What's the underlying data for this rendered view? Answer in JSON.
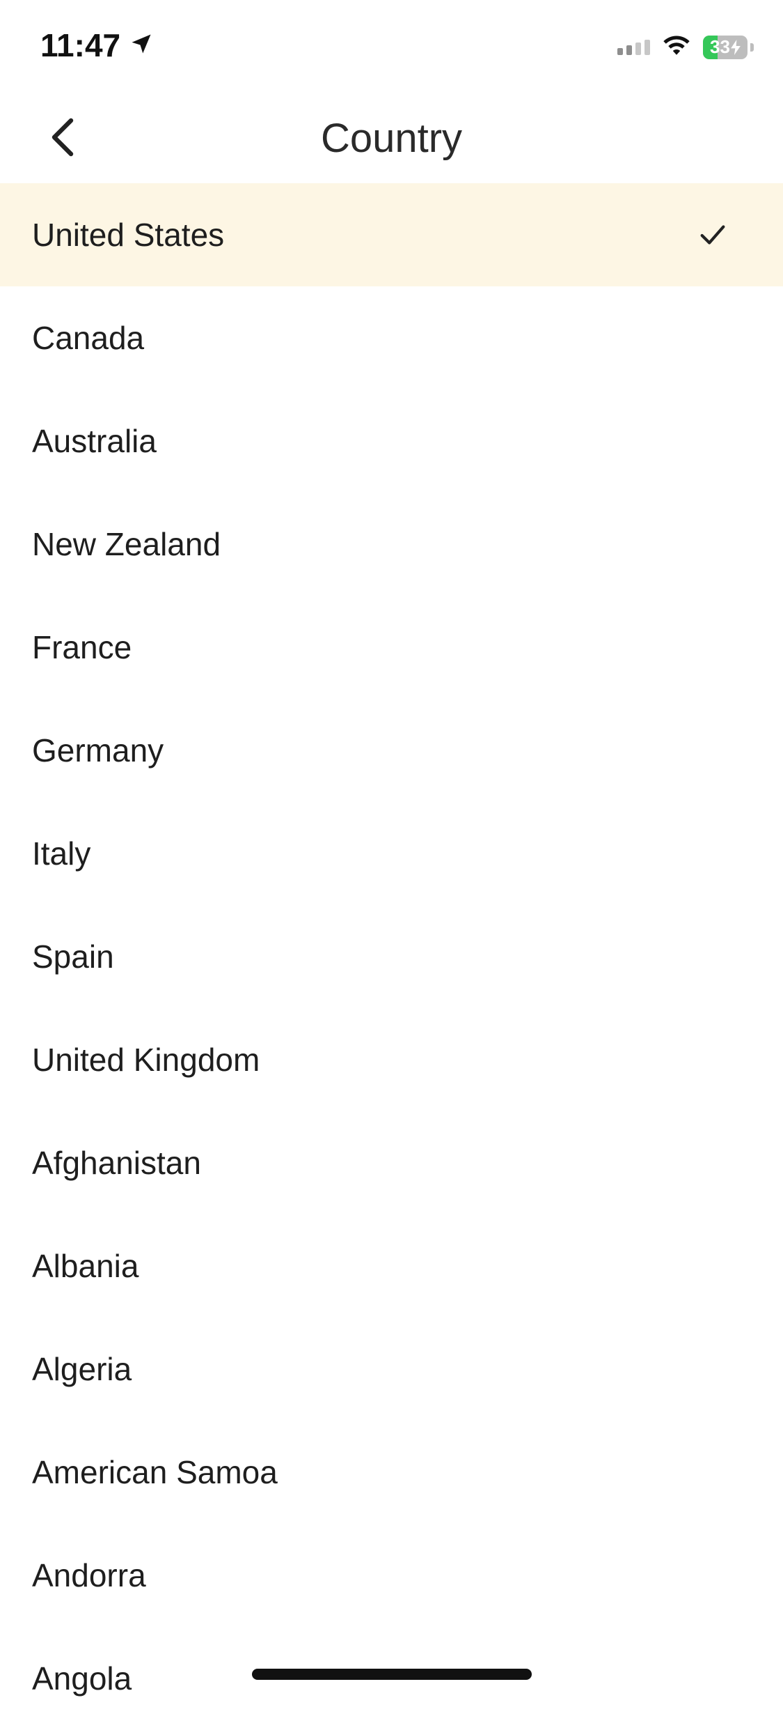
{
  "status_bar": {
    "time": "11:47",
    "battery_level": "33",
    "battery_fraction": 0.33,
    "icons": [
      "location-arrow-icon",
      "cellular-signal-icon",
      "wifi-icon",
      "battery-charging-icon"
    ]
  },
  "nav": {
    "title": "Country",
    "back_icon": "chevron-left-icon"
  },
  "countries": [
    {
      "label": "United States",
      "selected": true
    },
    {
      "label": "Canada",
      "selected": false
    },
    {
      "label": "Australia",
      "selected": false
    },
    {
      "label": "New Zealand",
      "selected": false
    },
    {
      "label": "France",
      "selected": false
    },
    {
      "label": "Germany",
      "selected": false
    },
    {
      "label": "Italy",
      "selected": false
    },
    {
      "label": "Spain",
      "selected": false
    },
    {
      "label": "United Kingdom",
      "selected": false
    },
    {
      "label": "Afghanistan",
      "selected": false
    },
    {
      "label": "Albania",
      "selected": false
    },
    {
      "label": "Algeria",
      "selected": false
    },
    {
      "label": "American Samoa",
      "selected": false
    },
    {
      "label": "Andorra",
      "selected": false
    },
    {
      "label": "Angola",
      "selected": false
    }
  ],
  "colors": {
    "selected_row_bg": "#fdf6e4",
    "battery_green": "#35c759"
  }
}
